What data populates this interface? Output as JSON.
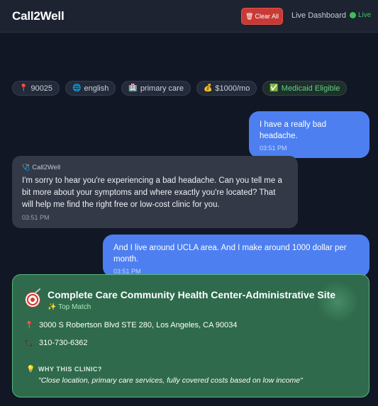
{
  "header": {
    "brand": "Call2Well",
    "clear_label": "Clear All",
    "dashboard_label": "Live Dashboard",
    "live_label": "Live"
  },
  "chips": [
    {
      "icon": "pin-icon",
      "label": "90025"
    },
    {
      "icon": "globe-icon",
      "label": "english"
    },
    {
      "icon": "hospital-icon",
      "label": "primary care"
    },
    {
      "icon": "money-bag-icon",
      "label": "$1000/mo"
    },
    {
      "icon": "check-icon",
      "label": "Medicaid Eligible"
    }
  ],
  "messages": [
    {
      "role": "user",
      "text": "I have a really bad headache.",
      "time": "03:51 PM"
    },
    {
      "role": "bot",
      "name": "Call2Well",
      "text": "I'm sorry to hear you're experiencing a bad headache. Can you tell me a bit more about your symptoms and where exactly you're located? That will help me find the right free or low-cost clinic for you.",
      "time": "03:51 PM"
    },
    {
      "role": "user",
      "text": "And I live around UCLA area. And I make around 1000 dollar per month.",
      "time": "03:51 PM"
    }
  ],
  "clinic": {
    "name": "Complete Care Community Health Center-Administrative Site",
    "badge": "Top Match",
    "address": "3000 S Robertson Blvd STE 280, Los Angeles, CA 90034",
    "phone": "310-730-6362",
    "why_label": "WHY THIS CLINIC?",
    "why_text": "\"Close location, primary care services, fully covered costs based on low income\""
  },
  "colors": {
    "accent_user": "#4d7ff0",
    "danger": "#c93a36",
    "live": "#3fbf5a",
    "card": "#2e6a4b"
  }
}
